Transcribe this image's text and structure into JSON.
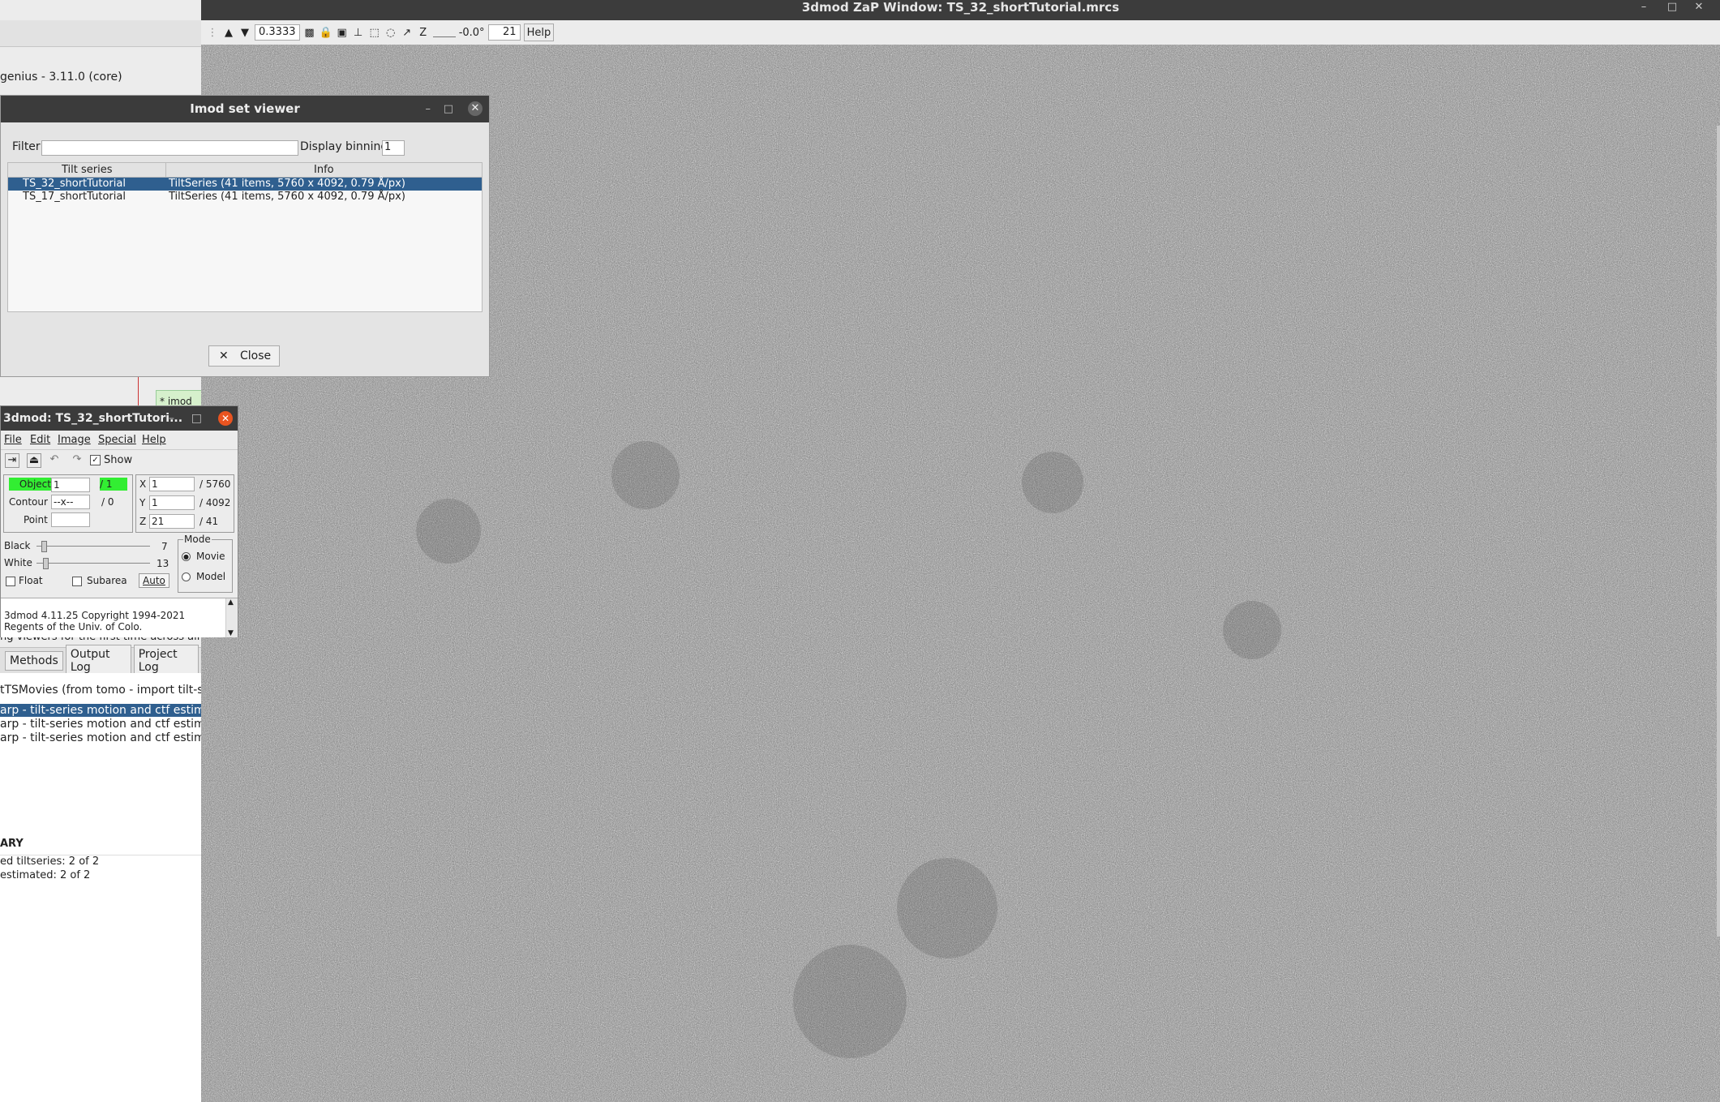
{
  "zap": {
    "title": "3dmod ZaP Window: TS_32_shortTutorial.mrcs",
    "zoom": "0.3333",
    "angle": "-0.0°",
    "section": "21",
    "help_label": "Help",
    "z_label": "Z"
  },
  "background_app": {
    "version_line": "genius - 3.11.0 (core)",
    "node_label": "* imod",
    "partial_line": "ng viewers for the first time across all",
    "tabs": [
      "Methods",
      "Output Log",
      "Project Log"
    ],
    "run_title": "tTSMovies   (from tomo - import tilt-ser",
    "runs": [
      "arp - tilt-series motion and ctf estimatio",
      "arp - tilt-series motion and ctf estimatio",
      "arp - tilt-series motion and ctf estimatio"
    ],
    "summary_heading": "ARY",
    "summary_lines": [
      "ed tiltseries: 2 of 2",
      "estimated: 2 of 2"
    ]
  },
  "set_viewer": {
    "title": "Imod set viewer",
    "filter_label": "Filter",
    "filter_value": "",
    "binning_label": "Display binning",
    "binning_value": "1",
    "columns": [
      "Tilt series",
      "Info"
    ],
    "rows": [
      {
        "name": "TS_32_shortTutorial",
        "info": "TiltSeries (41 items, 5760 x 4092, 0.79 Å/px)",
        "selected": true
      },
      {
        "name": "TS_17_shortTutorial",
        "info": "TiltSeries (41 items, 5760 x 4092, 0.79 Å/px)",
        "selected": false
      }
    ],
    "close_label": "Close"
  },
  "mod3d": {
    "title": "3dmod: TS_32_shortTutori...",
    "menus": [
      "File",
      "Edit",
      "Image",
      "Special",
      "Help"
    ],
    "show_label": "Show",
    "object_label": "Object",
    "object_value": "1",
    "object_total": "/ 1",
    "contour_label": "Contour",
    "contour_value": "--x--",
    "contour_total": "/ 0",
    "point_label": "Point",
    "point_value": "",
    "x_label": "X",
    "x_value": "1",
    "x_total": "/ 5760",
    "y_label": "Y",
    "y_value": "1",
    "y_total": "/ 4092",
    "z_label": "Z",
    "z_value": "21",
    "z_total": "/ 41",
    "black_label": "Black",
    "black_value": "7",
    "white_label": "White",
    "white_value": "13",
    "mode_label": "Mode",
    "movie_label": "Movie",
    "model_label": "Model",
    "float_label": "Float",
    "subarea_label": "Subarea",
    "auto_label": "Auto",
    "log_lines": [
      "3dmod 4.11.25 Copyright 1994-2021",
      "Regents of the Univ. of Colo."
    ]
  },
  "colors": {
    "titlebar": "#3c3c3c",
    "selection": "#2f5f8f",
    "object_green": "#32ee32",
    "close_orange": "#e95420"
  }
}
